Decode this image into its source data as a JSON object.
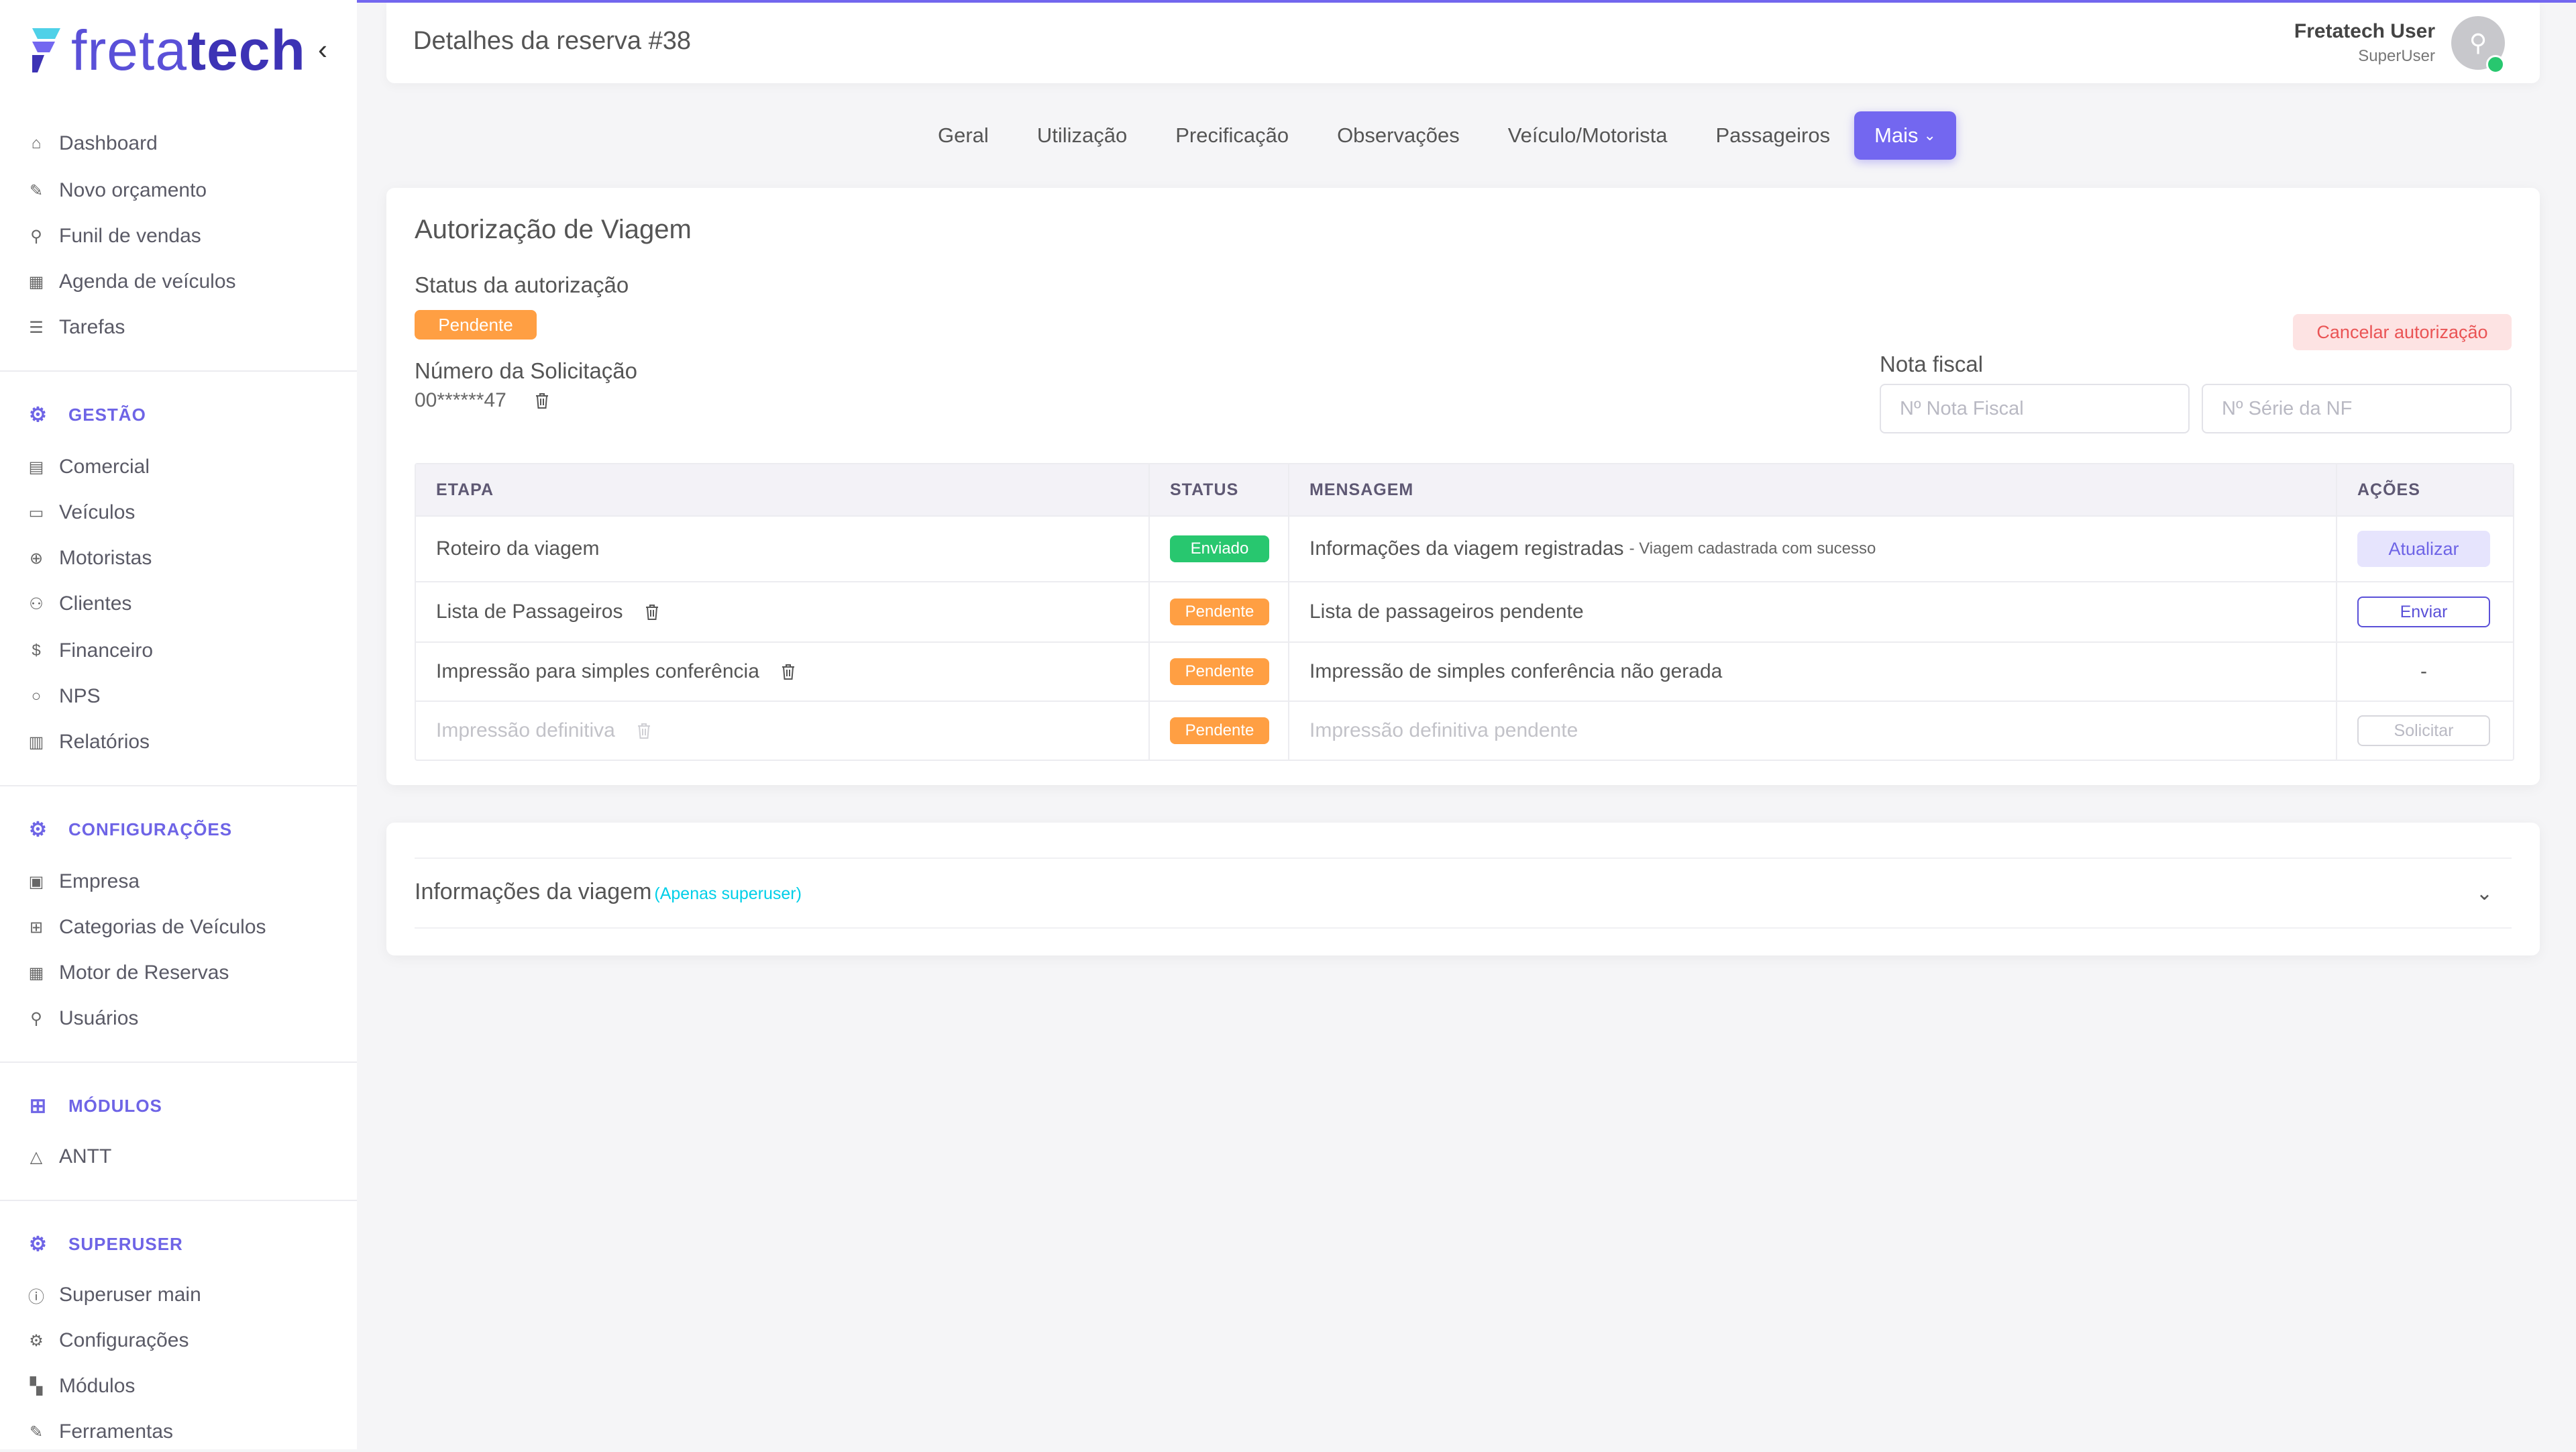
{
  "app": {
    "logo_light": "freta",
    "logo_bold": "tech"
  },
  "colors": {
    "primary": "#7367f0",
    "warning": "#ff9f43",
    "success": "#28c76f",
    "danger": "#ea5455",
    "info": "#00cfe8"
  },
  "sidebar": {
    "main_items": [
      {
        "label": "Dashboard",
        "icon": "home-icon"
      },
      {
        "label": "Novo orçamento",
        "icon": "edit-icon"
      },
      {
        "label": "Funil de vendas",
        "icon": "filter-icon"
      },
      {
        "label": "Agenda de veículos",
        "icon": "calendar-icon"
      },
      {
        "label": "Tarefas",
        "icon": "list-icon"
      }
    ],
    "gestao": {
      "title": "GESTÃO",
      "items": [
        {
          "label": "Comercial",
          "icon": "file-icon"
        },
        {
          "label": "Veículos",
          "icon": "truck-icon"
        },
        {
          "label": "Motoristas",
          "icon": "steering-icon"
        },
        {
          "label": "Clientes",
          "icon": "users-icon"
        },
        {
          "label": "Financeiro",
          "icon": "dollar-icon"
        },
        {
          "label": "NPS",
          "icon": "chat-icon"
        },
        {
          "label": "Relatórios",
          "icon": "report-icon"
        }
      ]
    },
    "config": {
      "title": "CONFIGURAÇÕES",
      "items": [
        {
          "label": "Empresa",
          "icon": "briefcase-icon"
        },
        {
          "label": "Categorias de Veículos",
          "icon": "grid-icon"
        },
        {
          "label": "Motor de Reservas",
          "icon": "table-icon"
        },
        {
          "label": "Usuários",
          "icon": "user-icon"
        }
      ]
    },
    "modulos": {
      "title": "MÓDULOS",
      "items": [
        {
          "label": "ANTT",
          "icon": "triangle-icon"
        }
      ]
    },
    "superuser": {
      "title": "SUPERUSER",
      "items": [
        {
          "label": "Superuser main",
          "icon": "info-icon"
        },
        {
          "label": "Configurações",
          "icon": "gear-icon"
        },
        {
          "label": "Módulos",
          "icon": "modules-icon"
        },
        {
          "label": "Ferramentas",
          "icon": "tool-icon"
        }
      ]
    }
  },
  "header": {
    "title": "Detalhes da reserva #38",
    "user_name": "Fretatech User",
    "user_role": "SuperUser"
  },
  "tabs": [
    "Geral",
    "Utilização",
    "Precificação",
    "Observações",
    "Veículo/Motorista",
    "Passageiros"
  ],
  "tab_more": "Mais",
  "auth": {
    "title": "Autorização de Viagem",
    "status_label": "Status da autorização",
    "status_value": "Pendente",
    "request_label": "Número da Solicitação",
    "request_number": "00******47",
    "cancel_button": "Cancelar autorização",
    "nota_label": "Nota fiscal",
    "nota_placeholder": "Nº Nota Fiscal",
    "serie_placeholder": "Nº Série da NF"
  },
  "table": {
    "headers": [
      "ETAPA",
      "STATUS",
      "MENSAGEM",
      "AÇÕES"
    ],
    "rows": [
      {
        "etapa": "Roteiro da viagem",
        "status": "Enviado",
        "mensagem": "Informações da viagem registradas",
        "detalhe": "- Viagem cadastrada com sucesso",
        "acao": "Atualizar"
      },
      {
        "etapa": "Lista de Passageiros",
        "status": "Pendente",
        "mensagem": "Lista de passageiros pendente",
        "acao": "Enviar"
      },
      {
        "etapa": "Impressão para simples conferência",
        "status": "Pendente",
        "mensagem": "Impressão de simples conferência não gerada",
        "acao": "-"
      },
      {
        "etapa": "Impressão definitiva",
        "status": "Pendente",
        "mensagem": "Impressão definitiva pendente",
        "acao": "Solicitar"
      }
    ]
  },
  "info": {
    "title": "Informações da viagem",
    "subtitle": "(Apenas superuser)"
  }
}
